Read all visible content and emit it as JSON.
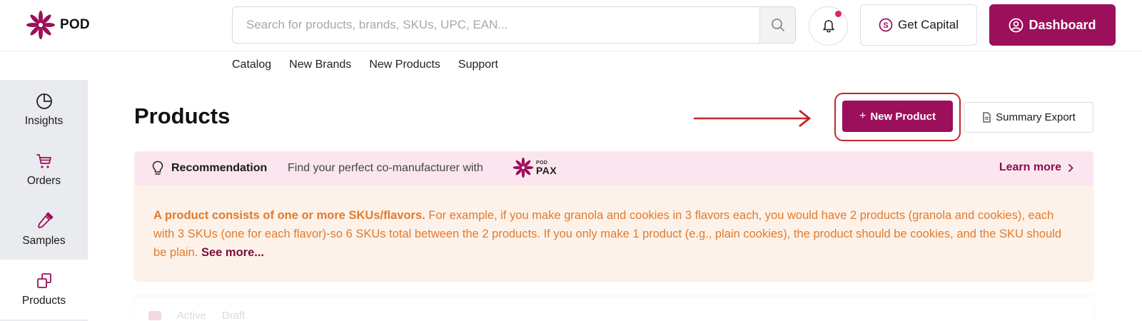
{
  "app": {
    "logo_text": "POD",
    "brand_color": "#9c0f5a"
  },
  "header": {
    "search_placeholder": "Search for products, brands, SKUs, UPC, EAN...",
    "notification_dot": true,
    "get_capital_label": "Get Capital",
    "dashboard_label": "Dashboard"
  },
  "nav": {
    "items": [
      "Catalog",
      "New Brands",
      "New Products",
      "Support"
    ]
  },
  "sidebar": {
    "items": [
      {
        "label": "Insights",
        "icon": "pie-chart-icon",
        "active": false
      },
      {
        "label": "Orders",
        "icon": "cart-icon",
        "active": false
      },
      {
        "label": "Samples",
        "icon": "dropper-icon",
        "active": false
      },
      {
        "label": "Products",
        "icon": "copy-squares-icon",
        "active": true
      }
    ]
  },
  "main": {
    "title": "Products",
    "new_product_label": "New Product",
    "summary_export_label": "Summary Export",
    "annotation_color": "#c0272d"
  },
  "recommendation": {
    "label": "Recommendation",
    "text": "Find your perfect co-manufacturer with",
    "pax_small": "POD",
    "pax_big": "PAX",
    "learn_more": "Learn more"
  },
  "info": {
    "bold": "A product consists of one or more SKUs/flavors.",
    "text": " For example, if you make granola and cookies in 3 flavors each, you would have 2 products (granola and cookies), each with 3 SKUs (one for each flavor)-so 6 SKUs total between the 2 products. If you only make 1 product (e.g., plain cookies), the product should be cookies, and the SKU should be plain. ",
    "see_more": "See more..."
  },
  "bottom_tabs": [
    "Active",
    "Draft"
  ]
}
